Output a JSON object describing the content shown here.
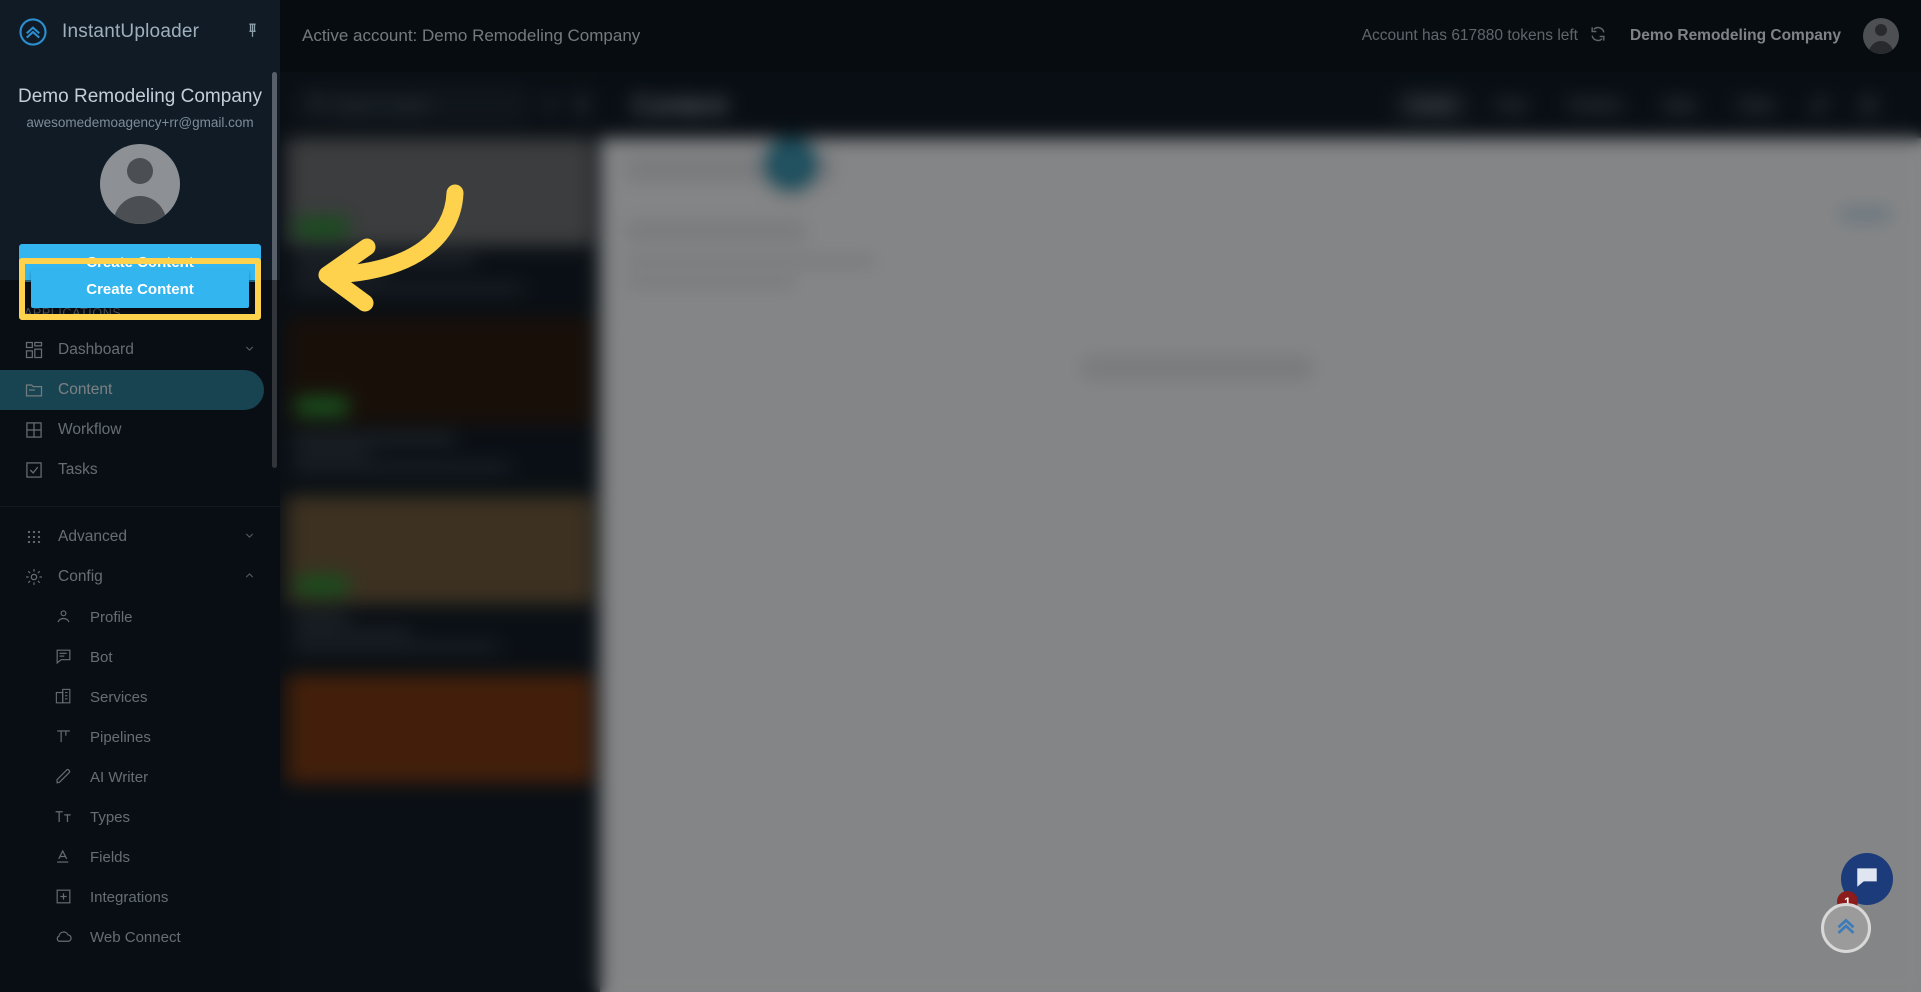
{
  "app": {
    "brand": "InstantUploader",
    "brand_logo_icon": "chevron-up-circle-logo",
    "pin_icon": "pin-icon",
    "accent_blue": "#33b5f0",
    "accent_teal": "#2d7b92",
    "highlight_yellow": "#ffd24d",
    "sidebar_bg": "#101b26"
  },
  "sidebar": {
    "account_name": "Demo Remodeling Company",
    "account_email": "awesomedemoagency+rr@gmail.com",
    "avatar_icon": "user-avatar-placeholder",
    "create_button": "Create Content",
    "section_label": "APPLICATIONS",
    "applications": [
      {
        "label": "Dashboard",
        "icon": "dashboard-grid-icon",
        "active": false,
        "chevron": "chevron-down-icon"
      },
      {
        "label": "Content",
        "icon": "folder-icon",
        "active": true,
        "chevron": ""
      },
      {
        "label": "Workflow",
        "icon": "table-grid-icon",
        "active": false,
        "chevron": ""
      },
      {
        "label": "Tasks",
        "icon": "checkbox-icon",
        "active": false,
        "chevron": ""
      }
    ],
    "groups": [
      {
        "label": "Advanced",
        "icon": "apps-dots-icon",
        "chevron": "chevron-down-icon"
      },
      {
        "label": "Config",
        "icon": "gear-icon",
        "chevron": "chevron-up-icon"
      }
    ],
    "config_items": [
      {
        "label": "Profile",
        "icon": "person-icon"
      },
      {
        "label": "Bot",
        "icon": "chat-lines-icon"
      },
      {
        "label": "Services",
        "icon": "building-icon"
      },
      {
        "label": "Pipelines",
        "icon": "pipeline-icon"
      },
      {
        "label": "AI Writer",
        "icon": "pencil-icon"
      },
      {
        "label": "Types",
        "icon": "text-size-icon"
      },
      {
        "label": "Fields",
        "icon": "letter-a-underline-icon"
      },
      {
        "label": "Integrations",
        "icon": "plus-box-icon"
      },
      {
        "label": "Web Connect",
        "icon": "cloud-icon"
      }
    ]
  },
  "topbar": {
    "active_account_text": "Active account: Demo Remodeling Company",
    "tokens_text": "Account has 617880 tokens left",
    "refresh_icon": "refresh-icon",
    "account_chip": "Demo Remodeling Company",
    "avatar_icon": "user-avatar-placeholder"
  },
  "list_pane": {
    "search_placeholder": "Search content",
    "search_value": "",
    "search_icon": "search-icon",
    "filter_icon": "filter-icon",
    "location_icon": "map-pin-icon",
    "collapse_icon": "chevron-left-icon",
    "cards": [
      {
        "badge_color": "#2e8b35",
        "thumb_color": "#6d6f71"
      },
      {
        "badge_color": "#2e8b35",
        "thumb_color": "#2c1d12"
      },
      {
        "badge_color": "#2e8b35",
        "thumb_color": "#6f5a3d"
      },
      {
        "badge_color": "#2e8b35",
        "thumb_color": "#7a3a14"
      }
    ]
  },
  "detail": {
    "title": "Content",
    "add_icon": "plus-icon",
    "tabs": [
      {
        "label": "Details",
        "active": true
      },
      {
        "label": "Chat",
        "active": false
      },
      {
        "label": "Timeline",
        "active": false
      },
      {
        "label": "Stats",
        "active": false
      },
      {
        "label": "Tasks",
        "active": false
      }
    ],
    "action_icons": [
      {
        "name": "pencil-edit-icon"
      },
      {
        "name": "trash-delete-icon"
      }
    ],
    "update_link": "Update"
  },
  "floating": {
    "chat_icon": "chat-bubble-icon",
    "chat_badge": "1",
    "scroll_top_icon": "chevron-up-circle-icon"
  },
  "annotation": {
    "arrow_icon": "curved-arrow-left-icon",
    "arrow_color": "#ffd24d",
    "target": "Create Content"
  }
}
